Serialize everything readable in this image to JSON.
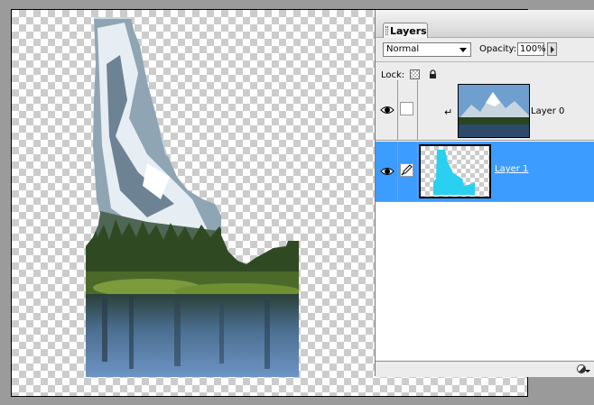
{
  "palette": {
    "tab_label": "Layers",
    "blend_mode": "Normal",
    "opacity_label": "Opacity:",
    "opacity_value": "100%",
    "lock_label": "Lock:"
  },
  "layers": [
    {
      "name": "Layer 0",
      "visible": true,
      "selected": false,
      "thumbnail": "mountain-lake-photo"
    },
    {
      "name": "Layer 1",
      "visible": true,
      "selected": true,
      "thumbnail": "idaho-shape-cyan"
    }
  ],
  "icons": {
    "visibility": "eye-icon",
    "brush": "brush-icon",
    "clip": "clipping-arrow-icon",
    "lock_transparency": "checker-lock-icon",
    "lock_all": "padlock-icon",
    "new_layer_effect": "half-circle-icon"
  },
  "colors": {
    "selection": "#3d9cff",
    "layer_shape": "#29d0f0"
  }
}
